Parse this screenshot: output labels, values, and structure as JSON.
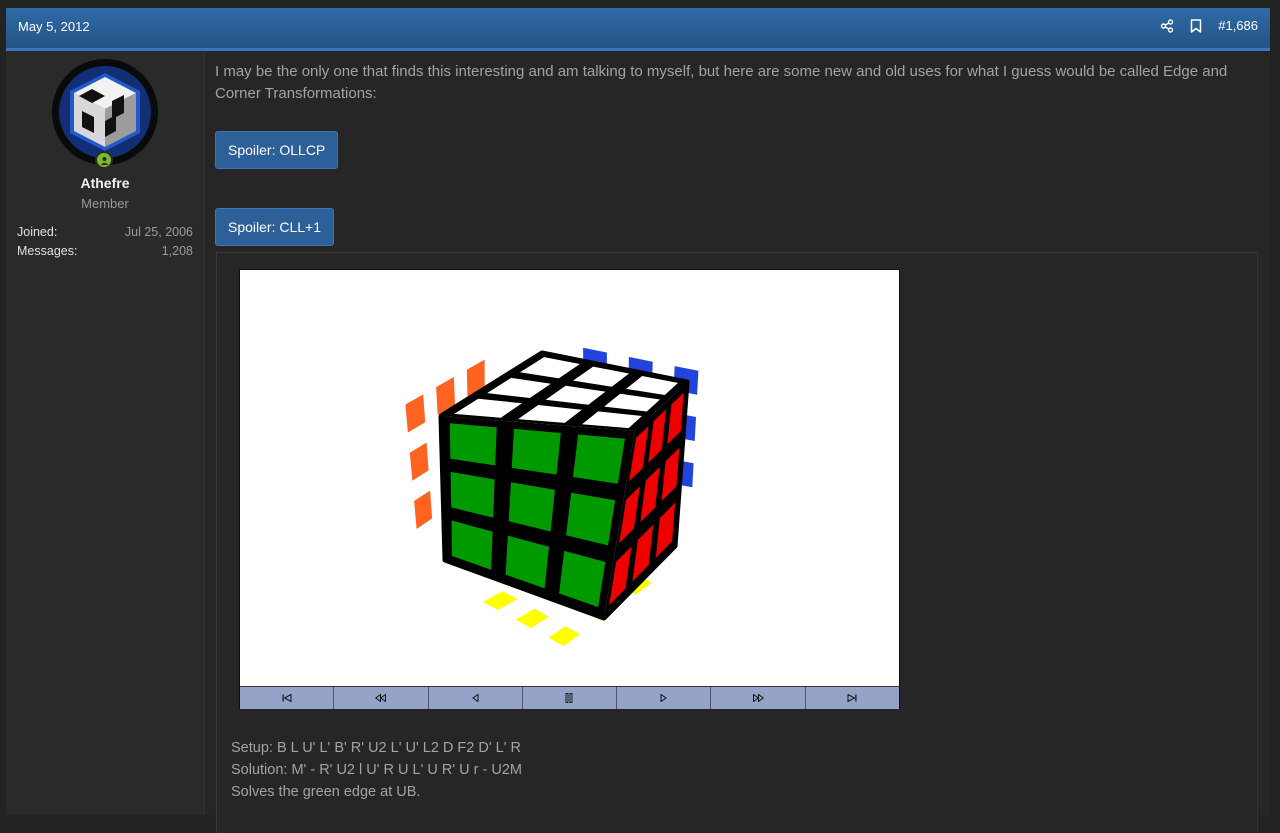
{
  "post": {
    "date": "May 5, 2012",
    "post_number": "#1,686",
    "header_icons": [
      "share-icon",
      "bookmark-icon"
    ]
  },
  "user": {
    "name": "Athefre",
    "title": "Member",
    "stats": [
      {
        "label": "Joined:",
        "value": "Jul 25, 2006"
      },
      {
        "label": "Messages:",
        "value": "1,208"
      }
    ]
  },
  "message": {
    "text": "I may be the only one that finds this interesting and am talking to myself, but here are some new and old uses for what I guess would be called Edge and Corner Transformations:"
  },
  "spoilers": [
    {
      "label": "Spoiler: OLLCP"
    },
    {
      "label": "Spoiler: CLL+1"
    }
  ],
  "spoiler_content": {
    "setup": "Setup: B L U' L' B' R' U2 L' U' L2 D F2 D' L' R",
    "solution": "Solution: M' - R' U2 l U' R U L' U R' U r - U2M",
    "note": "Solves the green edge at UB."
  },
  "cube_viewer": {
    "colors": {
      "top": "#ffffff",
      "front": "#009900",
      "right": "#ee0000",
      "left_ghost": "#ff6322",
      "back_ghost": "#2244dd",
      "bottom_ghost": "#ffff00"
    },
    "controls": [
      "rewind-icon",
      "step-back-icon",
      "play-back-icon",
      "pause-icon",
      "play-icon",
      "step-forward-icon",
      "fast-forward-icon"
    ]
  },
  "colors": {
    "header": "#2a5f98",
    "spoiler_button": "#2d5f99",
    "online": "#7dbb2b"
  }
}
